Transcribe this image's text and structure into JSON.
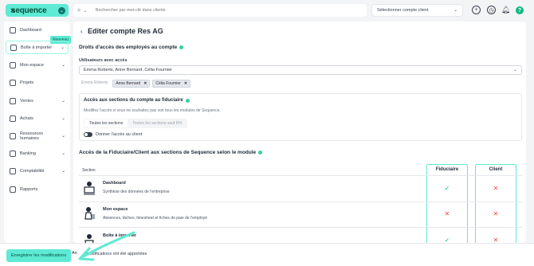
{
  "app": {
    "logo_text": "sequence",
    "logo_mark": "✕",
    "logo_chevron": "⌄"
  },
  "topbar": {
    "search_placeholder": "Rechercher par mot-clé dans clients",
    "company_select": "Sélectionner compte client",
    "icons": [
      "plus-circle-icon",
      "clock-icon",
      "bell-icon",
      "help-icon"
    ],
    "help_label": "?"
  },
  "sidebar": {
    "new_badge": "Nouveau",
    "items": [
      {
        "label": "Dashboard",
        "icon": "home-icon",
        "chevron": false
      },
      {
        "label": "Boîte à importer",
        "icon": "inbox-icon",
        "chevron": true
      },
      {
        "label": "Mon espace",
        "icon": "user-icon",
        "chevron": true
      },
      {
        "label": "Projets",
        "icon": "check-square-icon",
        "chevron": false
      },
      {
        "label": "Ventes",
        "icon": "bag-icon",
        "chevron": true
      },
      {
        "label": "Achats",
        "icon": "cart-icon",
        "chevron": true
      },
      {
        "label": "Ressources humaines",
        "icon": "people-icon",
        "chevron": true
      },
      {
        "label": "Banking",
        "icon": "bank-icon",
        "chevron": true
      },
      {
        "label": "Comptabilité",
        "icon": "calculator-icon",
        "chevron": true
      },
      {
        "label": "Rapports",
        "icon": "chart-icon",
        "chevron": false
      }
    ]
  },
  "main": {
    "title": "Editer compte Res AG",
    "rights_heading": "Droits d'accès des employés au compte",
    "users_label": "Utilisateurs avec accès",
    "users_value": "Emma Roberts, Anne Bernard, Célia Fournier",
    "chips": [
      {
        "label": "Emma Roberts",
        "removable": false
      },
      {
        "label": "Anne Bernard",
        "removable": true
      },
      {
        "label": "Célia Fournier",
        "removable": true
      }
    ],
    "fiduciary_box": {
      "title": "Accès aux sections du compte au fiduciaire",
      "description": "Modifiez l'accès si vous ne souhaitez pas voir tous les modules de Sequence.",
      "segments": [
        "Toutes les sections",
        "Toutes les sections sauf RH"
      ],
      "toggle_label": "Donner l'accès au client"
    },
    "sections_heading": "Accès de la Fiduciaire/Client aux sections de Sequence selon le module",
    "table": {
      "col_section": "Section",
      "col_fiduciaire": "Fiduciaire",
      "col_client": "Client",
      "rows": [
        {
          "name": "Dashboard",
          "desc": "Synthèse des données de l'entreprise",
          "fiduciaire": "check",
          "client": "cross"
        },
        {
          "name": "Mon espace",
          "desc": "Absences, tâches, timesheet et fiches de paie de l'employé",
          "fiduciaire": "cross",
          "client": "cross"
        },
        {
          "name": "Boîte à importer",
          "desc": "",
          "fiduciaire": "check",
          "client": "cross"
        }
      ]
    }
  },
  "footer": {
    "save_label": "Enregistrer les modifications",
    "cancel_label": "An",
    "message": "modifications ont été apportées"
  },
  "colors": {
    "accent": "#5eead4",
    "check": "#10b981",
    "cross": "#ef4444"
  }
}
